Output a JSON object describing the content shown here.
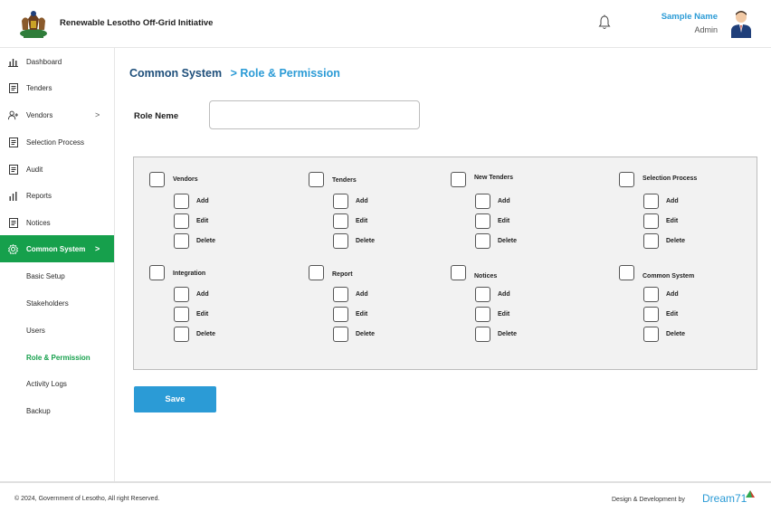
{
  "header": {
    "org_name": "Renewable Lesotho Off-Grid Initiative",
    "user_name": "Sample Name",
    "user_role": "Admin"
  },
  "sidebar": {
    "items": [
      {
        "label": "Dashboard",
        "icon": "bar-chart-icon"
      },
      {
        "label": "Tenders",
        "icon": "document-icon"
      },
      {
        "label": "Vendors",
        "icon": "user-add-icon",
        "chevron": ">"
      },
      {
        "label": "Selection Process",
        "icon": "document-icon"
      },
      {
        "label": "Audit",
        "icon": "document-icon"
      },
      {
        "label": "Reports",
        "icon": "bar-chart-icon"
      },
      {
        "label": "Notices",
        "icon": "document-icon"
      },
      {
        "label": "Common System",
        "icon": "gear-icon",
        "chevron": ">",
        "active": true
      }
    ],
    "sub_items": [
      {
        "label": "Basic Setup"
      },
      {
        "label": "Stakeholders"
      },
      {
        "label": "Users"
      },
      {
        "label": "Role & Permission",
        "active": true
      },
      {
        "label": "Activity Logs"
      },
      {
        "label": "Backup"
      }
    ]
  },
  "breadcrumb": {
    "root": "Common System",
    "separator": ">",
    "current": "Role & Permission"
  },
  "form": {
    "role_label": "Role Neme",
    "role_value": "",
    "save_label": "Save"
  },
  "permissions": [
    {
      "name": "Vendors",
      "actions": [
        "Add",
        "Edit",
        "Delete"
      ]
    },
    {
      "name": "Tenders",
      "actions": [
        "Add",
        "Edit",
        "Delete"
      ]
    },
    {
      "name": "New Tenders",
      "actions": [
        "Add",
        "Edit",
        "Delete"
      ]
    },
    {
      "name": "Selection Process",
      "actions": [
        "Add",
        "Edit",
        "Delete"
      ]
    },
    {
      "name": "Integration",
      "actions": [
        "Add",
        "Edit",
        "Delete"
      ]
    },
    {
      "name": "Report",
      "actions": [
        "Add",
        "Edit",
        "Delete"
      ]
    },
    {
      "name": "Notices",
      "actions": [
        "Add",
        "Edit",
        "Delete"
      ]
    },
    {
      "name": "Common System",
      "actions": [
        "Add",
        "Edit",
        "Delete"
      ]
    }
  ],
  "footer": {
    "copyright": "© 2024, Government of Lesotho, All right Reserved.",
    "design_by": "Design & Development by",
    "brand": "Dream71"
  },
  "colors": {
    "accent_green": "#16a04c",
    "accent_blue": "#2b9bd6",
    "title_navy": "#1d4e7a"
  }
}
